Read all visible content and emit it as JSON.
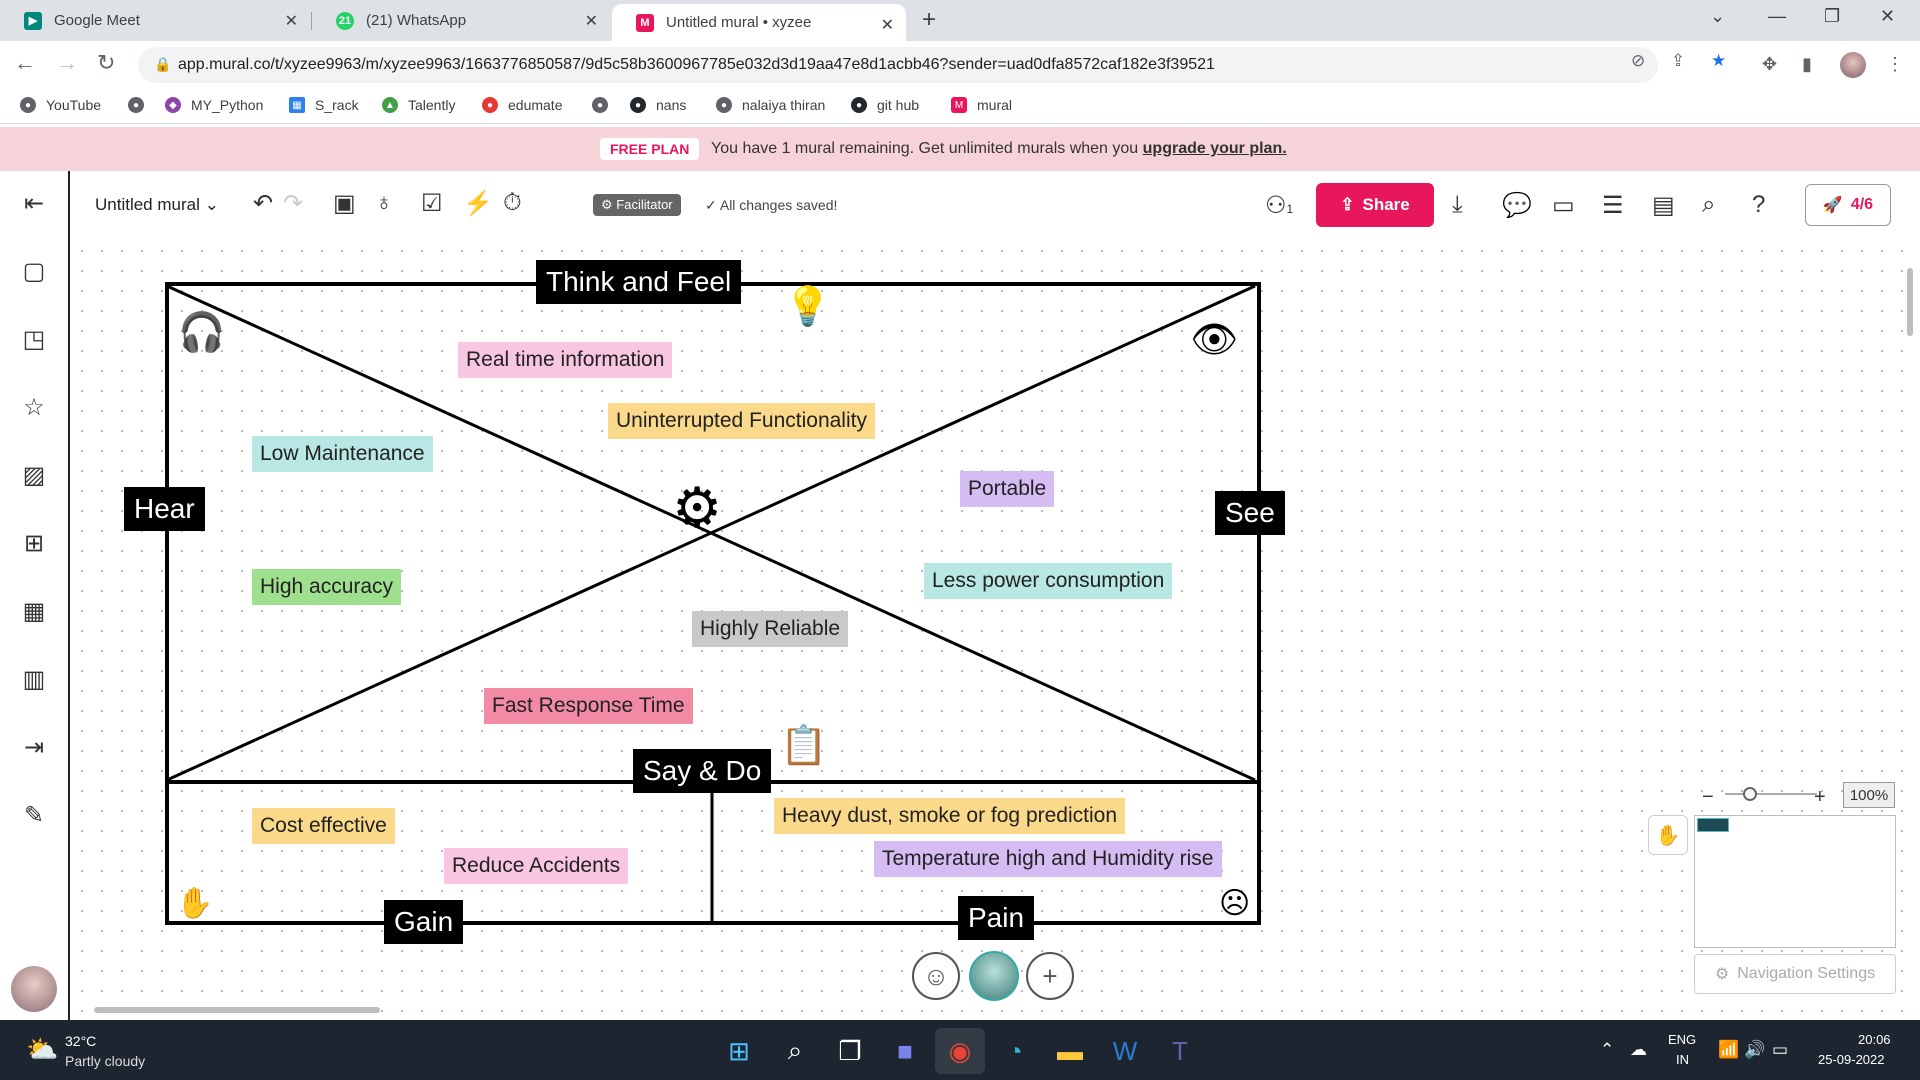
{
  "browser": {
    "tabs": [
      {
        "title": "Google Meet",
        "icon": "google-meet-icon",
        "color": "#00897b"
      },
      {
        "title": "(21) WhatsApp",
        "icon": "whatsapp-icon",
        "color": "#25d366",
        "badge": "21"
      },
      {
        "title": "Untitled mural • xyzee",
        "icon": "mural-icon",
        "color": "#e8175d",
        "active": true
      }
    ],
    "url": "app.mural.co/t/xyzee9963/m/xyzee9963/1663776850587/9d5c58b3600967785e032d3d19aa47e8d1acbb46?sender=uad0dfa8572caf182e3f39521",
    "bookmarks": [
      "YouTube",
      "MY_Python",
      "S_rack",
      "Talently",
      "edumate",
      "nans",
      "nalaiya thiran",
      "git hub",
      "mural"
    ]
  },
  "banner": {
    "badge": "FREE PLAN",
    "text": "You have 1 mural remaining. Get unlimited murals when you ",
    "link": "upgrade your plan."
  },
  "toolbar": {
    "mural_title": "Untitled mural",
    "facilitator": "Facilitator",
    "saved": "All changes saved!",
    "user_count": "1",
    "share": "Share",
    "progress": "4/6"
  },
  "board": {
    "labels": {
      "think_feel": "Think and Feel",
      "hear": "Hear",
      "see": "See",
      "say_do": "Say & Do",
      "gain": "Gain",
      "pain": "Pain"
    },
    "stickies": [
      {
        "text": "Real time information",
        "color": "#f9c6e2"
      },
      {
        "text": "Uninterrupted Functionality",
        "color": "#fbd98a"
      },
      {
        "text": "Low Maintenance",
        "color": "#b9e7e4"
      },
      {
        "text": "Portable",
        "color": "#d5bdf4"
      },
      {
        "text": "High accuracy",
        "color": "#9fe08f"
      },
      {
        "text": "Less power consumption",
        "color": "#b9e7e4"
      },
      {
        "text": "Highly Reliable",
        "color": "#c9c9c9"
      },
      {
        "text": "Fast Response Time",
        "color": "#f28aa6"
      },
      {
        "text": "Heavy dust, smoke or fog prediction",
        "color": "#fbd98a"
      },
      {
        "text": "Temperature high and Humidity rise",
        "color": "#d5bdf4"
      },
      {
        "text": "Cost effective",
        "color": "#fbd98a"
      },
      {
        "text": "Reduce Accidents",
        "color": "#f9c6e2"
      }
    ]
  },
  "zoom": {
    "level": "100%"
  },
  "nav_settings": "Navigation Settings",
  "taskbar": {
    "temp": "32°C",
    "weather": "Partly cloudy",
    "lang": "ENG",
    "region": "IN",
    "time": "20:06",
    "date": "25-09-2022"
  }
}
